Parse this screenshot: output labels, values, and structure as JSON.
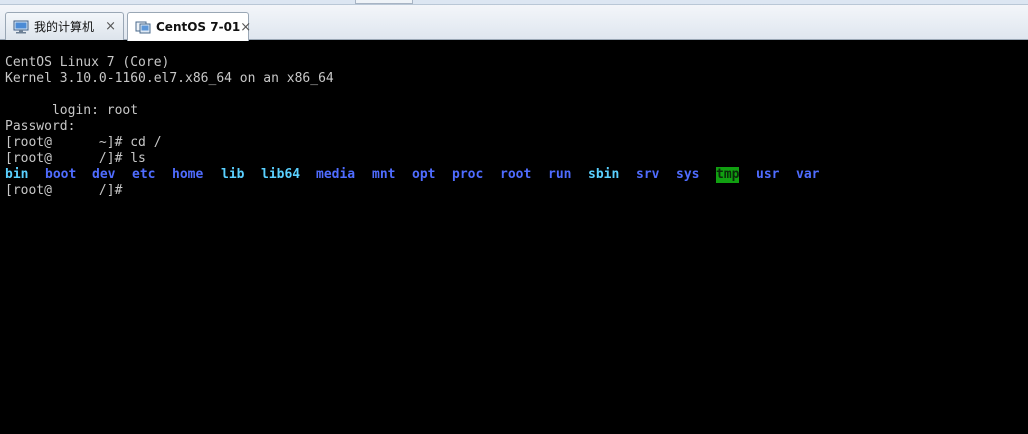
{
  "tabs": [
    {
      "label": "我的计算机",
      "icon": "computer-icon",
      "close": "×",
      "active": false
    },
    {
      "label": "CentOS 7-01",
      "icon": "vm-icon",
      "close": "×",
      "active": true
    }
  ],
  "terminal": {
    "lines": [
      "CentOS Linux 7 (Core)",
      "Kernel 3.10.0-1160.el7.x86_64 on an x86_64",
      "",
      "      login: root",
      "Password:",
      "[root@      ~]# cd /",
      "[root@      /]# ls"
    ],
    "ls_output": [
      {
        "name": "bin",
        "color": "#5ad0ff"
      },
      {
        "name": "boot",
        "color": "#4f6cff"
      },
      {
        "name": "dev",
        "color": "#4f6cff"
      },
      {
        "name": "etc",
        "color": "#4f6cff"
      },
      {
        "name": "home",
        "color": "#4f6cff"
      },
      {
        "name": "lib",
        "color": "#5ad0ff"
      },
      {
        "name": "lib64",
        "color": "#5ad0ff"
      },
      {
        "name": "media",
        "color": "#4f6cff"
      },
      {
        "name": "mnt",
        "color": "#4f6cff"
      },
      {
        "name": "opt",
        "color": "#4f6cff"
      },
      {
        "name": "proc",
        "color": "#4f6cff"
      },
      {
        "name": "root",
        "color": "#4f6cff"
      },
      {
        "name": "run",
        "color": "#4f6cff"
      },
      {
        "name": "sbin",
        "color": "#5ad0ff"
      },
      {
        "name": "srv",
        "color": "#4f6cff"
      },
      {
        "name": "sys",
        "color": "#4f6cff"
      },
      {
        "name": "tmp",
        "color": "#0a2a0a",
        "highlight": "#11a011"
      },
      {
        "name": "usr",
        "color": "#4f6cff"
      },
      {
        "name": "var",
        "color": "#4f6cff"
      }
    ],
    "prompt_after": "[root@      /]#"
  }
}
